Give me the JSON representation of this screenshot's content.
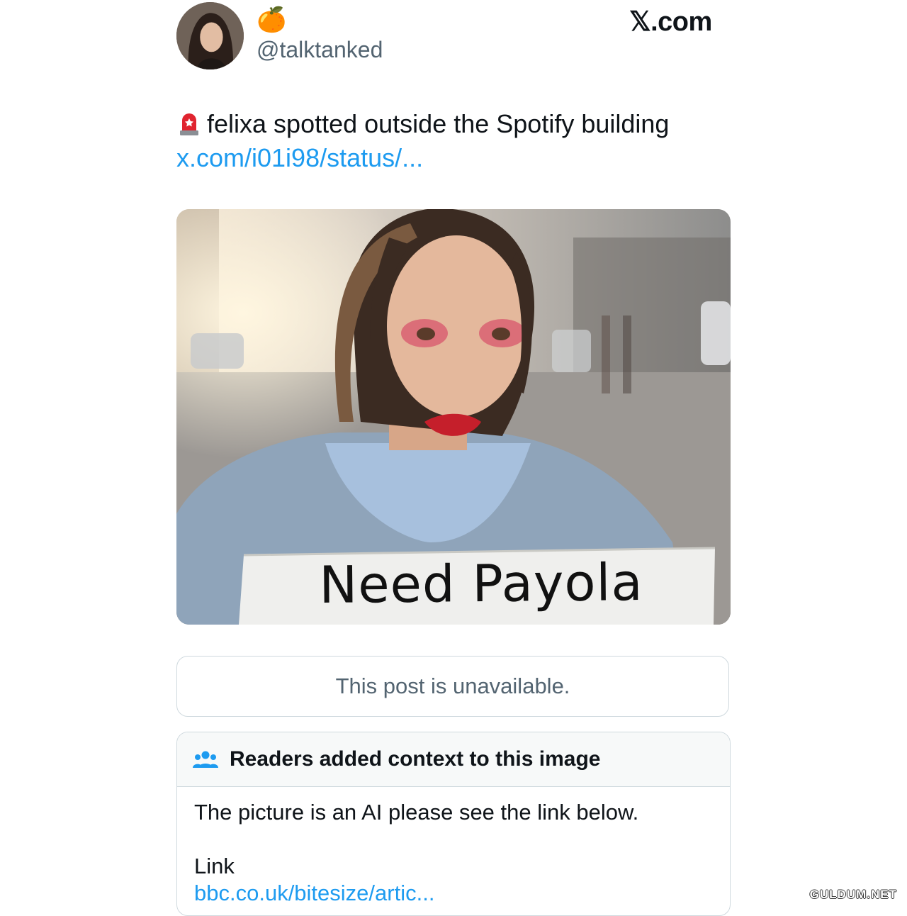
{
  "header": {
    "display_name": "🍊",
    "handle": "@talktanked",
    "brand": "𝕏.com"
  },
  "tweet": {
    "text": "felixa spotted outside the Spotify building",
    "link": "x.com/i01i98/status/..."
  },
  "media": {
    "sign_text": "Need Payola"
  },
  "quote": {
    "unavailable_text": "This post is unavailable."
  },
  "community_note": {
    "title": "Readers added context to this image",
    "body": "The picture is an AI please see the link below.",
    "link_label": "Link",
    "link_url": "bbc.co.uk/bitesize/artic..."
  },
  "watermark": "GULDUM.NET",
  "colors": {
    "link": "#1d9bf0",
    "secondary_text": "#536471",
    "border": "#cfd9de"
  },
  "icons": {
    "tweet_prefix": "siren-icon",
    "note_header": "people-icon"
  }
}
